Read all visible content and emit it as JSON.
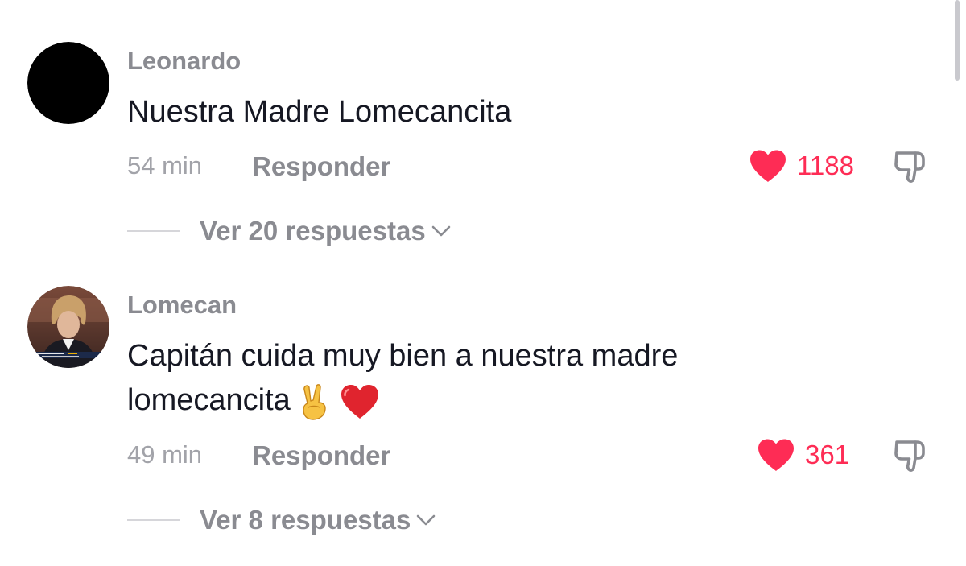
{
  "comments": [
    {
      "username": "Leonardo",
      "text": "Nuestra Madre Lomecancita",
      "time": "54 min",
      "reply_label": "Responder",
      "likes": "1188",
      "replies_label": "Ver 20 respuestas"
    },
    {
      "username": "Lomecan",
      "text_line1": "Capitán cuida muy bien a nuestra madre",
      "text_line2": "lomecancita",
      "emojis": [
        "victory-hand-emoji",
        "red-heart-emoji"
      ],
      "time": "49 min",
      "reply_label": "Responder",
      "likes": "361",
      "replies_label": "Ver 8 respuestas"
    }
  ],
  "colors": {
    "like": "#fe2c55",
    "muted_text": "#8a8b91",
    "time_text": "#a2a3a9",
    "body_text": "#161823"
  },
  "icons": [
    "heart-icon",
    "dislike-icon",
    "chevron-down-icon"
  ]
}
